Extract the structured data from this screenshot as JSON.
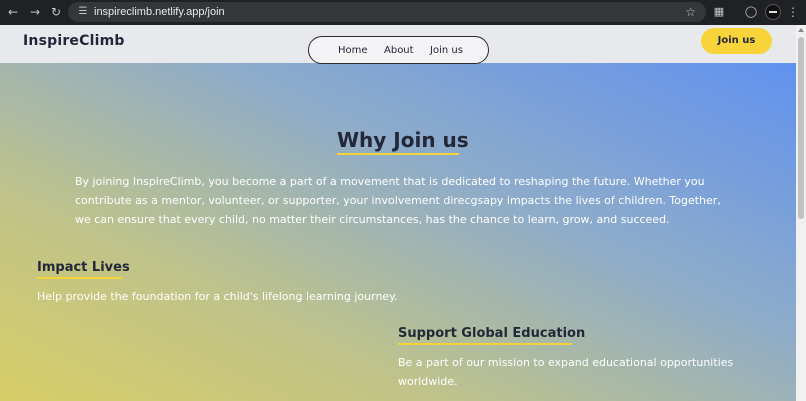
{
  "browser": {
    "url": "inspireclimb.netlify.app/join",
    "icons": [
      "back-icon",
      "forward-icon",
      "reload-icon",
      "site-settings-icon",
      "star-icon",
      "extensions-icon",
      "sync-icon",
      "profile-icon",
      "menu-icon"
    ]
  },
  "site": {
    "logo": "InspireClimb",
    "nav": [
      "Home",
      "About",
      "Join us"
    ],
    "cta": "Join us"
  },
  "hero": {
    "title": "Why Join us",
    "body": "By joining InspireClimb, you become a part of a movement that is dedicated to reshaping the future. Whether you contribute as a mentor, volunteer, or supporter, your involvement direcgsapy impacts the lives of children. Together, we can ensure that every child, no matter their circumstances, has the chance to learn, grow, and succeed."
  },
  "features": [
    {
      "title": "Impact Lives",
      "body": "Help provide the foundation for a child's lifelong learning journey."
    },
    {
      "title": "Support Global Education",
      "body": "Be a part of our mission to expand educational opportunities worldwide."
    }
  ],
  "colors": {
    "accent": "#f7d43a",
    "text_dark": "#232838",
    "gradient_start": "#d8cd66",
    "gradient_end": "#5a8ef5"
  }
}
